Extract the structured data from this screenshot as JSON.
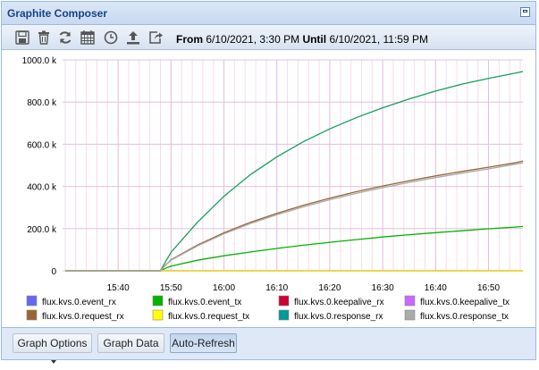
{
  "window": {
    "title": "Graphite Composer"
  },
  "toolbar": {
    "buttons": [
      {
        "icon": "save-icon"
      },
      {
        "icon": "trash-icon"
      },
      {
        "icon": "refresh-icon"
      },
      {
        "icon": "calendar-icon"
      },
      {
        "icon": "clock-icon"
      },
      {
        "icon": "upload-icon"
      },
      {
        "icon": "share-icon"
      }
    ],
    "range": {
      "from_label": "From",
      "from_value": "6/10/2021, 3:30 PM",
      "until_label": "Until",
      "until_value": "6/10/2021, 11:59 PM"
    }
  },
  "bottom": {
    "graph_options_label": "Graph Options",
    "graph_data_label": "Graph Data",
    "auto_refresh_label": "Auto-Refresh"
  },
  "chart_data": {
    "type": "line",
    "title": "",
    "xlabel": "",
    "ylabel": "",
    "grid": true,
    "legend_position": "bottom",
    "x_ticks": [
      "15:40",
      "15:50",
      "16:00",
      "16:10",
      "16:20",
      "16:30",
      "16:40",
      "16:50"
    ],
    "x_tick_minutes": [
      10,
      20,
      30,
      40,
      50,
      60,
      70,
      80
    ],
    "x_range_minutes": [
      -0.5,
      86.5
    ],
    "y_ticks": [
      "0",
      "200.0 k",
      "400.0 k",
      "600.0 k",
      "800.0 k",
      "1000.0 k"
    ],
    "ylim": [
      0,
      1000000
    ],
    "x": [
      0,
      18,
      19,
      20,
      25,
      30,
      35,
      40,
      45,
      50,
      55,
      60,
      65,
      70,
      75,
      80,
      85,
      86.5
    ],
    "series": [
      {
        "name": "flux.kvs.0.event_rx",
        "color": "#6666ff",
        "values": [
          0,
          0,
          0,
          0,
          0,
          0,
          0,
          0,
          0,
          0,
          0,
          0,
          0,
          0,
          0,
          0,
          0,
          0
        ]
      },
      {
        "name": "flux.kvs.0.event_tx",
        "color": "#00b400",
        "values": [
          0,
          0,
          12000,
          22000,
          50000,
          71000,
          89000,
          106000,
          121000,
          135000,
          148000,
          160000,
          171000,
          181000,
          190000,
          199000,
          207000,
          210000
        ]
      },
      {
        "name": "flux.kvs.0.keepalive_rx",
        "color": "#cc0033",
        "values": [
          0,
          0,
          0,
          0,
          0,
          0,
          0,
          0,
          0,
          0,
          0,
          0,
          0,
          0,
          0,
          0,
          0,
          0
        ]
      },
      {
        "name": "flux.kvs.0.keepalive_tx",
        "color": "#cc66ff",
        "values": [
          0,
          0,
          0,
          0,
          0,
          0,
          0,
          0,
          0,
          0,
          0,
          0,
          0,
          0,
          0,
          0,
          0,
          0
        ]
      },
      {
        "name": "flux.kvs.0.request_rx",
        "color": "#996633",
        "values": [
          0,
          0,
          28000,
          52000,
          122000,
          180000,
          230000,
          272000,
          310000,
          344000,
          375000,
          402000,
          427000,
          450000,
          471000,
          491000,
          512000,
          520000
        ]
      },
      {
        "name": "flux.kvs.0.request_tx",
        "color": "#ffff00",
        "values": [
          0,
          0,
          0,
          0,
          0,
          0,
          0,
          0,
          0,
          0,
          0,
          0,
          0,
          0,
          0,
          0,
          0,
          0
        ]
      },
      {
        "name": "flux.kvs.0.response_rx",
        "color": "#009999",
        "values": [
          0,
          0,
          45000,
          88000,
          230000,
          353000,
          456000,
          540000,
          612000,
          673000,
          726000,
          773000,
          815000,
          852000,
          885000,
          912000,
          937000,
          945000
        ]
      },
      {
        "name": "flux.kvs.0.response_tx",
        "color": "#aaaaaa",
        "values": [
          0,
          0,
          27000,
          50000,
          118000,
          175000,
          224000,
          266000,
          303000,
          337000,
          367000,
          394000,
          419000,
          442000,
          463000,
          483000,
          505000,
          512000
        ]
      }
    ],
    "response_rx_display_color": "#12a05a"
  }
}
